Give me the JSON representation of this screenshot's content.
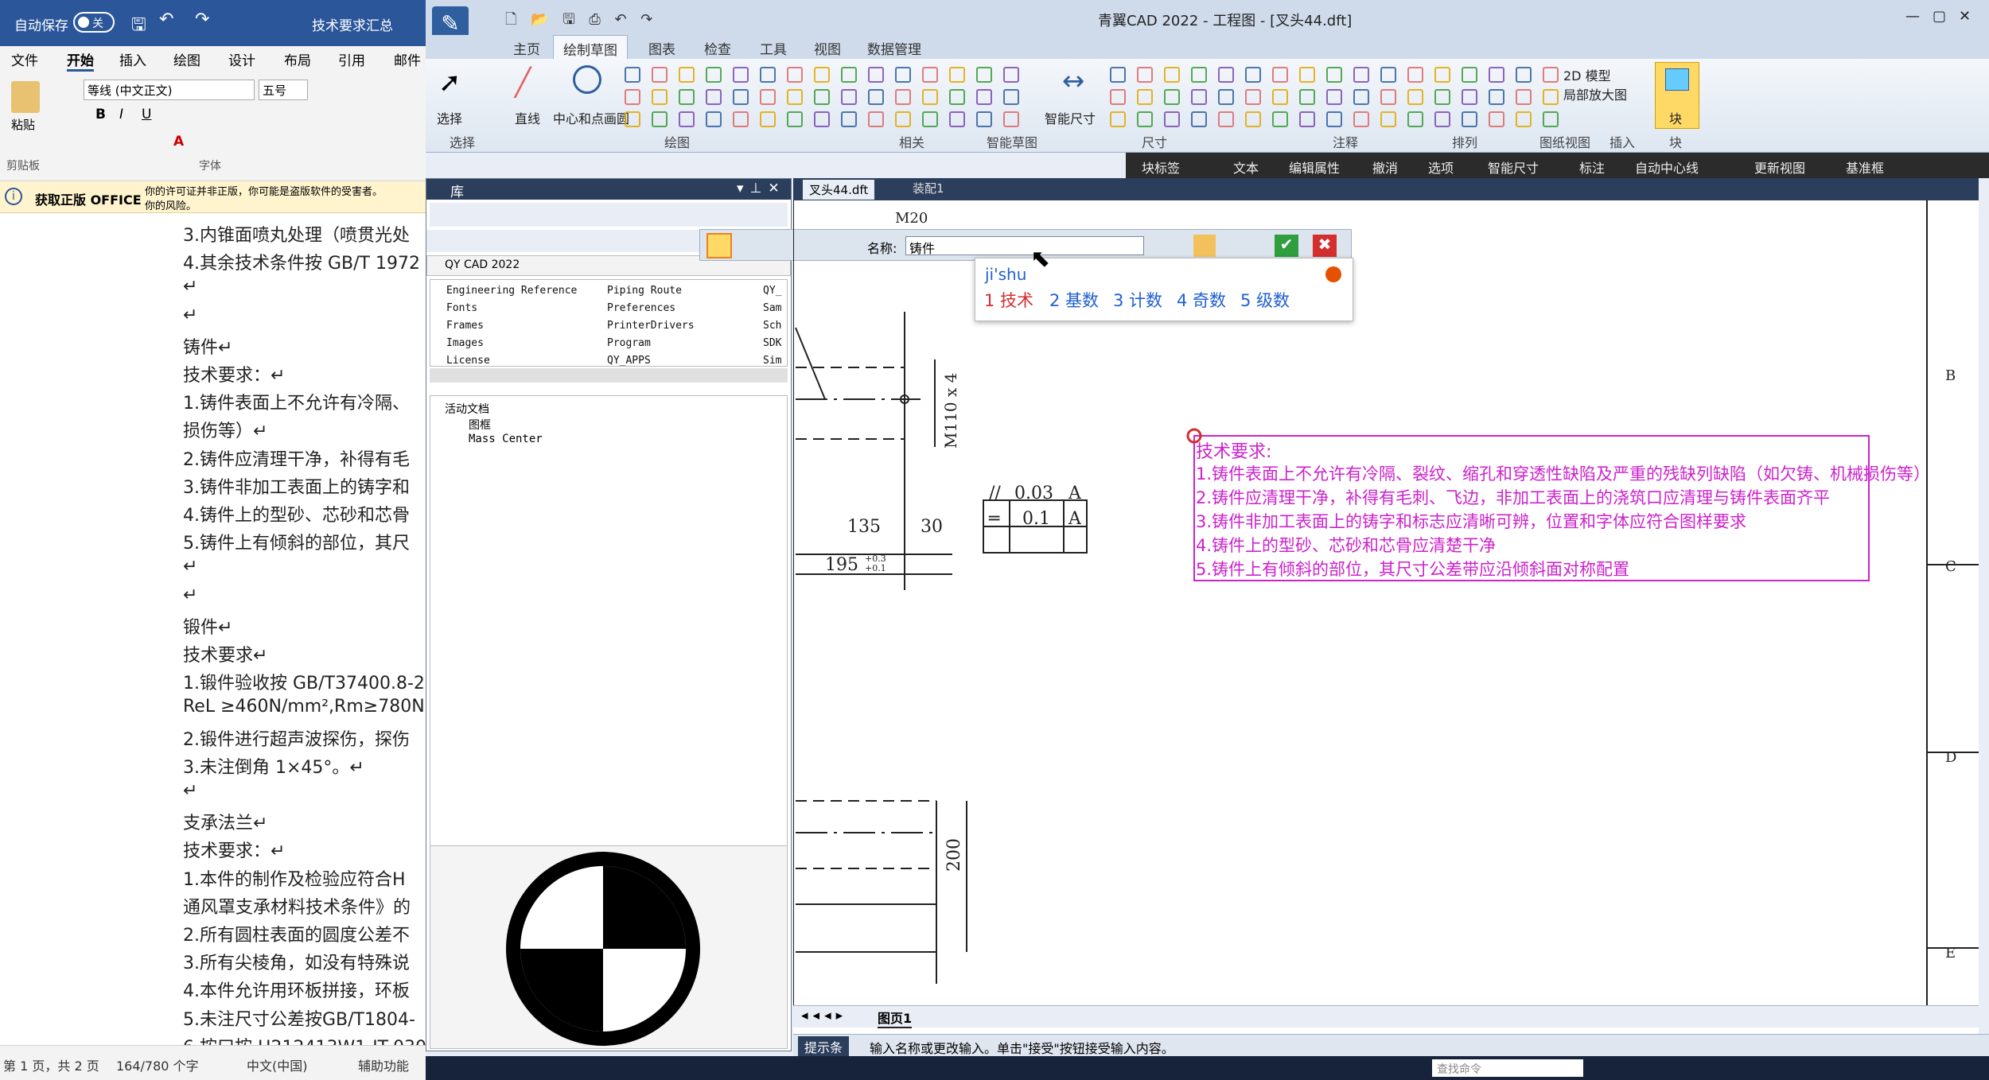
{
  "word": {
    "title_autosave": "自动保存",
    "autosave_state": "关",
    "doc_name": "技术要求汇总",
    "tabs": [
      "文件",
      "开始",
      "插入",
      "绘图",
      "设计",
      "布局",
      "引用",
      "邮件"
    ],
    "font_name": "等线 (中文正文)",
    "font_size": "五号",
    "groups": {
      "clipboard": "剪贴板",
      "font": "字体"
    },
    "paste_label": "粘贴",
    "msg_title": "获取正版 OFFICE",
    "msg_text_1": "你的许可证并非正版，你可能是盗版软件的受害者。",
    "msg_text_2": "你的风险。",
    "doc_lines": [
      "3.内锥面喷丸处理（喷贯光处",
      "4.其余技术条件按 GB/T 1972",
      "↵",
      "↵",
      "铸件↵",
      "技术要求：↵",
      "1.铸件表面上不允许有冷隔、",
      "损伤等）↵",
      "2.铸件应清理干净，补得有毛",
      "3.铸件非加工表面上的铸字和",
      "4.铸件上的型砂、芯砂和芯骨",
      "5.铸件上有倾斜的部位，其尺",
      "↵",
      "↵",
      "锻件↵",
      "技术要求↵",
      "1.锻件验收按 GB/T37400.8-2",
      "ReL ≥460N/mm²,Rm≥780N",
      "2.锻件进行超声波探伤，探伤",
      "3.未注倒角 1×45°。↵",
      "↵",
      "支承法兰↵",
      "技术要求：↵",
      "1.本件的制作及检验应符合H",
      "通风罩支承材料技术条件》的",
      "2.所有圆柱表面的圆度公差不",
      "3.所有尖棱角，如没有特殊说",
      "4.本件允许用环板拼接，环板",
      "5.未注尺寸公差按GB/T1804-",
      "6.按口按  H212413W1-IT-030"
    ],
    "status": {
      "page": "第 1 页，共 2 页",
      "words": "164/780 个字",
      "lang": "中文(中国)",
      "assist": "辅助功能"
    }
  },
  "cad": {
    "title": "青翼CAD 2022 - 工程图 - [叉头44.dft]",
    "tabs": [
      "主页",
      "绘制草图",
      "图表",
      "检查",
      "工具",
      "视图",
      "数据管理"
    ],
    "active_tab": "绘制草图",
    "ribbon_groups": [
      "选择",
      "绘图",
      "相关",
      "智能草图",
      "尺寸",
      "注释",
      "排列",
      "图纸视图",
      "插入",
      "块"
    ],
    "ribbon_buttons": {
      "select": "选择",
      "line": "直线",
      "circle": "中心和点画圆",
      "smart_dim": "智能尺寸",
      "model2d": "2D 模型",
      "detail": "局部放大图",
      "block": "块"
    },
    "toolbar2": [
      "块标签",
      "文本",
      "编辑属性",
      "撤消",
      "选项",
      "智能尺寸",
      "标注",
      "自动中心线",
      "更新视图",
      "基准框"
    ],
    "library": {
      "title": "库",
      "path": "QY CAD 2022",
      "folders": [
        "Engineering Reference",
        "Fonts",
        "Frames",
        "Images",
        "License",
        "Piping Route",
        "Preferences",
        "PrinterDrivers",
        "Program",
        "QY_APPS",
        "QY_",
        "Sam",
        "Sch",
        "SDK",
        "Sim"
      ],
      "tree_root": "活动文档",
      "tree_items": [
        "图框",
        "Mass Center"
      ]
    },
    "doc_tabs": [
      "叉头44.dft",
      "装配1"
    ],
    "block_bar": {
      "name_label": "名称:",
      "name_value": "铸件"
    },
    "ime": {
      "input": "ji'shu",
      "candidates": [
        "1 技术",
        "2 基数",
        "3 计数",
        "4 奇数",
        "5 级数"
      ]
    },
    "requirements": [
      "技术要求:",
      "1.铸件表面上不允许有冷隔、裂纹、缩孔和穿透性缺陷及严重的残缺列缺陷（如欠铸、机械损伤等）",
      "2.铸件应清理干净，补得有毛刺、飞边，非加工表面上的浇筑口应清理与铸件表面齐平",
      "3.铸件非加工表面上的铸字和标志应清晰可辨，位置和字体应符合图样要求",
      "4.铸件上的型砂、芯砂和芯骨应清楚干净",
      "5.铸件上有倾斜的部位，其尺寸公差带应沿倾斜面对称配置"
    ],
    "dims": {
      "m20": "M20",
      "m110": "M110 x 4",
      "d135": "135",
      "d30": "30",
      "d195": "195",
      "tol_up": "+0.3",
      "tol_dn": "+0.1",
      "d200": "200"
    },
    "fcf": [
      {
        "sym": "//",
        "val": "0.03",
        "ref": "A"
      },
      {
        "sym": "═",
        "val": "0.1",
        "ref": "A"
      }
    ],
    "zone_letters": [
      "B",
      "C",
      "D",
      "E"
    ],
    "sheet_tab": "图页1",
    "status_label": "提示条",
    "status_text": "输入名称或更改输入。单击\"接受\"按钮接受输入内容。",
    "cmd_placeholder": "查找命令"
  },
  "colors": {
    "word_blue": "#2b579a",
    "magenta": "#cc22cc",
    "cad_ribbon": "#dde6f1"
  }
}
